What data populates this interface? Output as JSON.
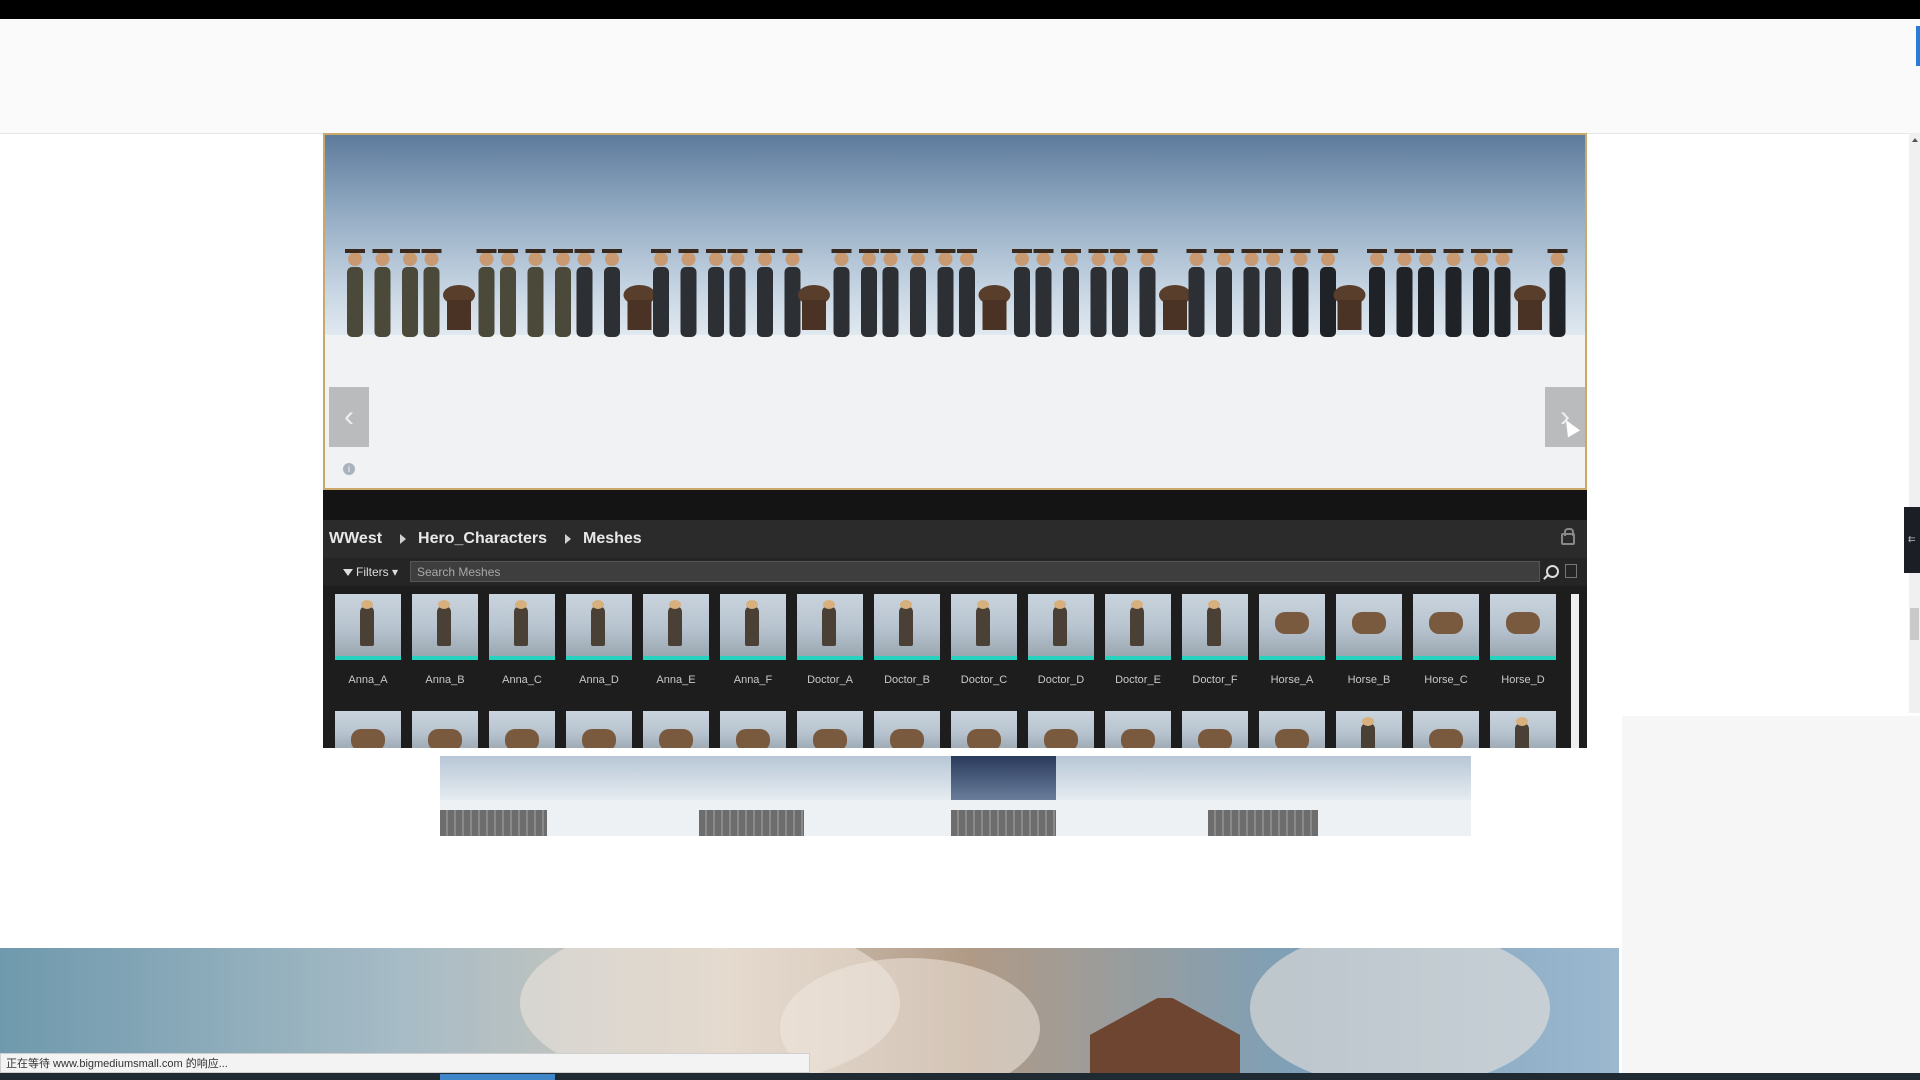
{
  "breadcrumb": {
    "items": [
      "WWest",
      "Hero_Characters",
      "Meshes"
    ]
  },
  "filters": {
    "label": "Filters",
    "search_placeholder": "Search Meshes"
  },
  "assets": [
    {
      "label": "Anna_A",
      "kind": "person"
    },
    {
      "label": "Anna_B",
      "kind": "person"
    },
    {
      "label": "Anna_C",
      "kind": "person"
    },
    {
      "label": "Anna_D",
      "kind": "person"
    },
    {
      "label": "Anna_E",
      "kind": "person"
    },
    {
      "label": "Anna_F",
      "kind": "person"
    },
    {
      "label": "Doctor_A",
      "kind": "person"
    },
    {
      "label": "Doctor_B",
      "kind": "person"
    },
    {
      "label": "Doctor_C",
      "kind": "person"
    },
    {
      "label": "Doctor_D",
      "kind": "person"
    },
    {
      "label": "Doctor_E",
      "kind": "person"
    },
    {
      "label": "Doctor_F",
      "kind": "person"
    },
    {
      "label": "Horse_A",
      "kind": "horse"
    },
    {
      "label": "Horse_B",
      "kind": "horse"
    },
    {
      "label": "Horse_C",
      "kind": "horse"
    },
    {
      "label": "Horse_D",
      "kind": "horse"
    }
  ],
  "second_row_kinds": [
    "horse",
    "horse",
    "horse",
    "horse",
    "horse",
    "horse",
    "horse",
    "horse",
    "horse",
    "horse",
    "horse",
    "horse",
    "horse",
    "person",
    "horse",
    "person"
  ],
  "gallery_thumbnails": 8,
  "status_bar": {
    "text": "正在等待 www.bigmediumsmall.com 的响应..."
  },
  "colors": {
    "accent_selection": "#27d3bf",
    "editor_bg": "#1d1d1d"
  }
}
